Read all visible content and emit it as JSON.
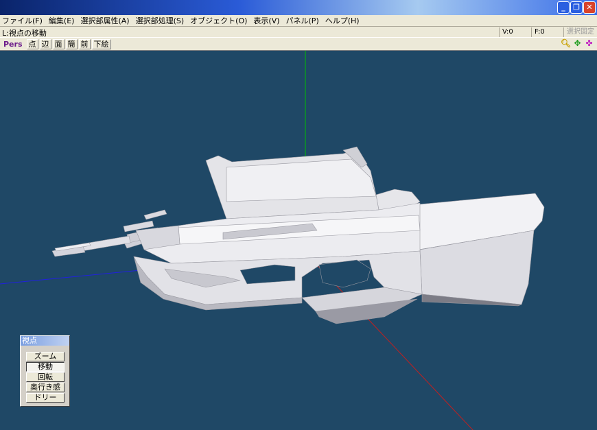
{
  "window": {
    "title": ""
  },
  "menu": [
    "ファイル(F)",
    "編集(E)",
    "選択部属性(A)",
    "選択部処理(S)",
    "オブジェクト(O)",
    "表示(V)",
    "パネル(P)",
    "ヘルプ(H)"
  ],
  "status": {
    "message": "L:視点の移動",
    "vertex": "V:0",
    "face": "F:0",
    "lock": "選択固定"
  },
  "toolbar": {
    "pers": "Pers",
    "buttons": [
      "点",
      "辺",
      "面",
      "簡",
      "前",
      "下絵"
    ],
    "icons": [
      "zoom-icon",
      "move-icon",
      "rotate-icon"
    ]
  },
  "viewpoint_panel": {
    "title": "視点",
    "buttons": [
      "ズーム",
      "移動",
      "回転",
      "奥行き感",
      "ドリー"
    ],
    "active": "移動"
  },
  "colors": {
    "viewport_bg": "#1f4866",
    "model": "#e8e8ec",
    "axis_y": "#00c000",
    "axis_x": "#c02020",
    "axis_z": "#2020e0"
  }
}
